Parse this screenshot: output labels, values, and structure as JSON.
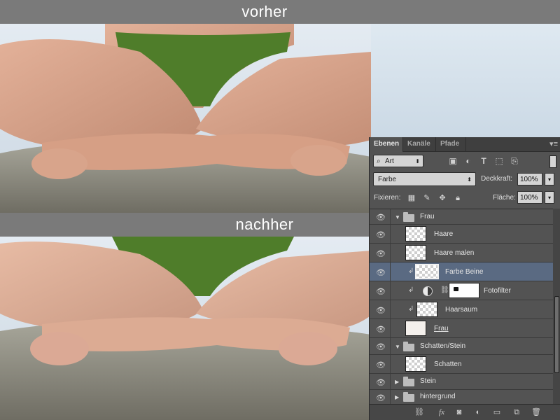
{
  "captions": {
    "before": "vorher",
    "after": "nachher"
  },
  "panel": {
    "tabs": [
      {
        "label": "Ebenen",
        "active": true
      },
      {
        "label": "Kanäle",
        "active": false
      },
      {
        "label": "Pfade",
        "active": false
      }
    ],
    "menu_icon": "panel-menu-icon",
    "filter": {
      "kind_label": "Art",
      "icons": [
        "image-filter-icon",
        "adjustment-filter-icon",
        "type-filter-icon",
        "shape-filter-icon",
        "smart-object-filter-icon"
      ]
    },
    "blend_mode": "Farbe",
    "opacity_label": "Deckkraft:",
    "opacity_value": "100%",
    "lock_label": "Fixieren:",
    "fill_label": "Fläche:",
    "fill_value": "100%",
    "layers": [
      {
        "name": "Frau",
        "type": "group",
        "expanded": true
      },
      {
        "name": "Haare",
        "type": "pixel"
      },
      {
        "name": "Haare malen",
        "type": "pixel"
      },
      {
        "name": "Farbe Beine",
        "type": "pixel",
        "clipped": true,
        "selected": true
      },
      {
        "name": "Fotofilter",
        "type": "adjustment",
        "clipped": true
      },
      {
        "name": "Haarsaum",
        "type": "pixel",
        "clipped": true
      },
      {
        "name": "Frau",
        "type": "pixel"
      },
      {
        "name": "Schatten/Stein",
        "type": "group",
        "expanded": true
      },
      {
        "name": "Schatten",
        "type": "pixel"
      },
      {
        "name": "Stein",
        "type": "group",
        "expanded": false
      },
      {
        "name": "hintergrund",
        "type": "group",
        "expanded": false
      }
    ],
    "bottom_icons": [
      "link-layers-icon",
      "fx-icon",
      "add-mask-icon",
      "new-adjustment-icon",
      "new-group-icon",
      "new-layer-icon",
      "trash-icon"
    ],
    "fx_label": "fx"
  },
  "colors": {
    "panel_bg": "#535353",
    "selected_row": "#5a6a82",
    "swimsuit": "#4f7d2a",
    "skin": "#d9a48a"
  }
}
